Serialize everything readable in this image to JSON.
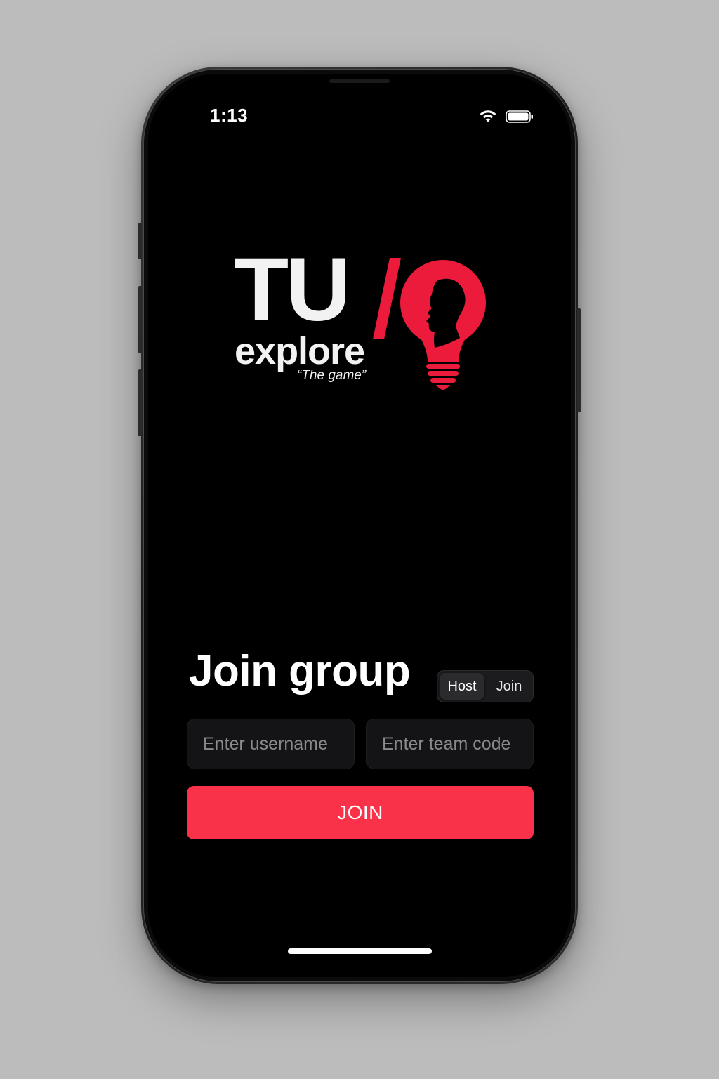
{
  "status_bar": {
    "time": "1:13",
    "wifi_icon": "wifi-icon",
    "battery_icon": "battery-icon"
  },
  "logo": {
    "line1": "TU",
    "line2": "explore",
    "tagline": "“The game”",
    "accent_color": "#ec1b3b",
    "text_color": "#f2f2f2"
  },
  "join_form": {
    "title": "Join group",
    "segmented": {
      "host_label": "Host",
      "join_label": "Join",
      "selected": "Host"
    },
    "username_placeholder": "Enter username",
    "team_code_placeholder": "Enter team code",
    "join_label": "JOIN",
    "button_color": "#f9324a"
  },
  "colors": {
    "screen_background": "#000000",
    "field_background": "#141416",
    "page_background": "#bdbcbc"
  }
}
